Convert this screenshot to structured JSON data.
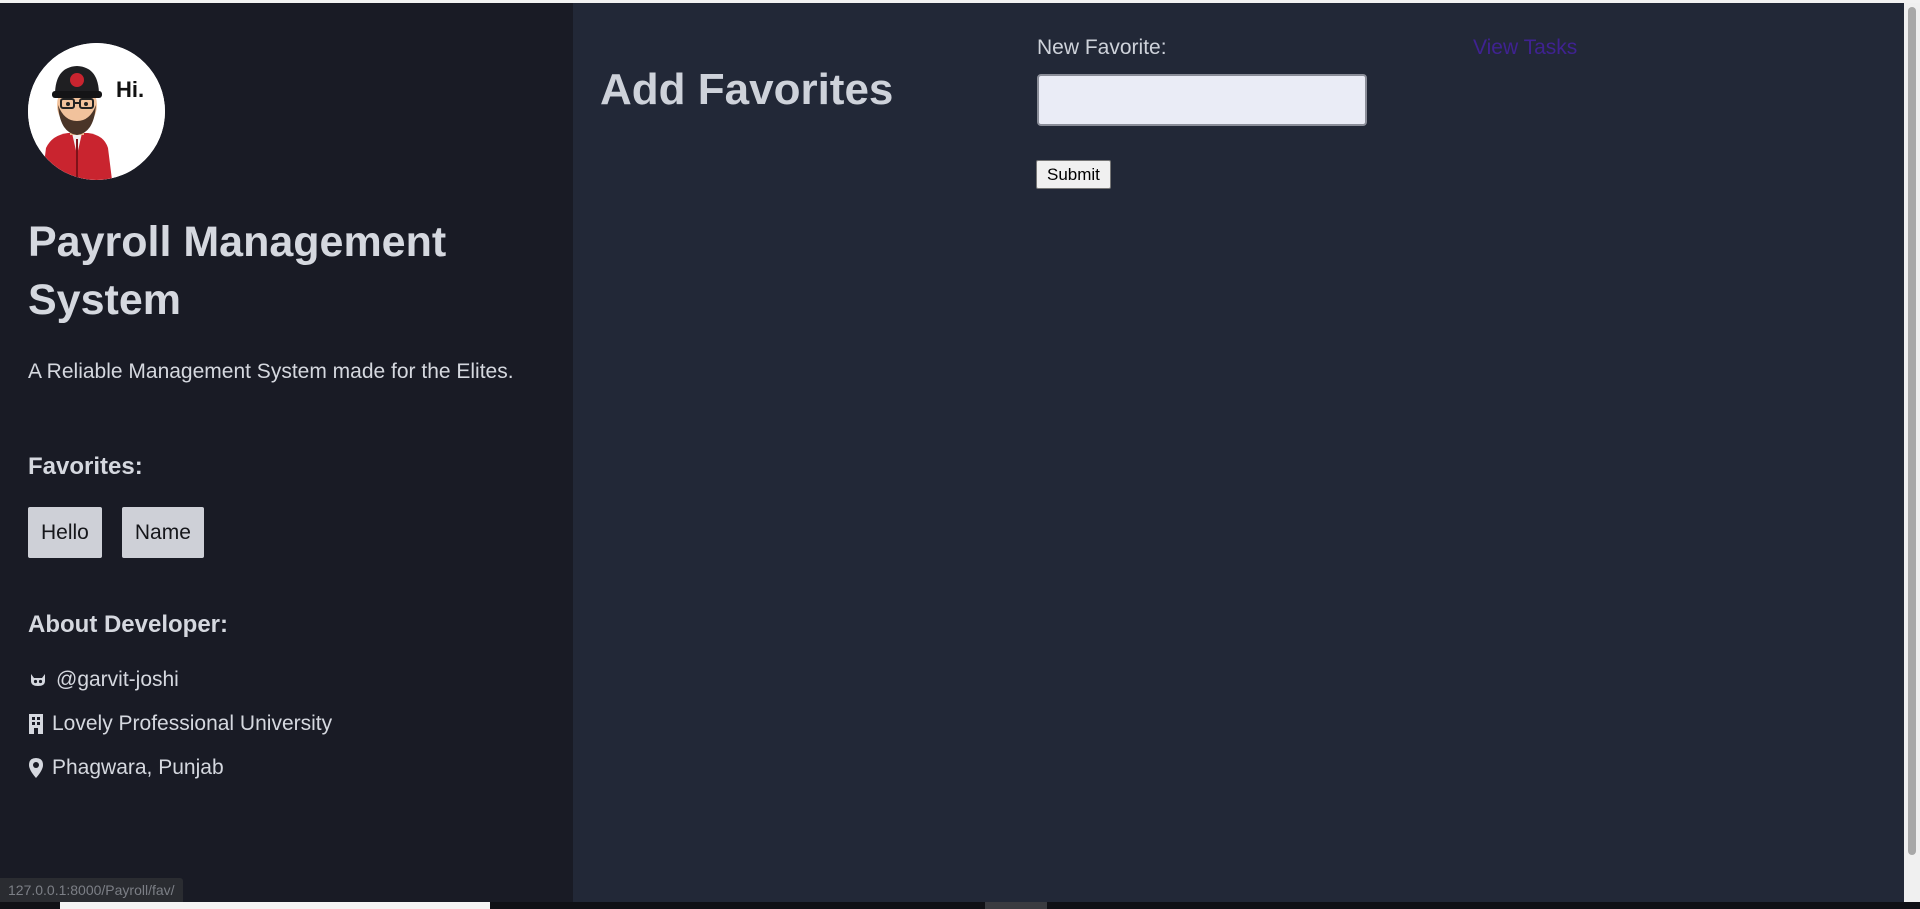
{
  "sidebar": {
    "avatar_greeting": "Hi.",
    "site_title": "Payroll Management System",
    "tagline": "A Reliable Management System made for the Elites.",
    "favorites_heading": "Favorites:",
    "favorites": [
      {
        "label": "Hello"
      },
      {
        "label": "Name"
      }
    ],
    "about_heading": "About Developer:",
    "about": [
      {
        "icon": "github-icon",
        "text": "@garvit-joshi"
      },
      {
        "icon": "building-icon",
        "text": "Lovely Professional University"
      },
      {
        "icon": "map-marker-icon",
        "text": "Phagwara, Punjab"
      }
    ]
  },
  "main": {
    "title": "Add Favorites",
    "form": {
      "label": "New Favorite:",
      "input_value": "",
      "submit_label": "Submit"
    },
    "view_tasks_link": "View Tasks"
  },
  "status_bar": {
    "url": "127.0.0.1:8000/Payroll/fav/"
  },
  "colors": {
    "sidebar_bg": "#191b25",
    "main_bg": "#222837",
    "text": "#d5d8df",
    "link": "#3f2291",
    "chip_bg": "#ced0d7"
  }
}
